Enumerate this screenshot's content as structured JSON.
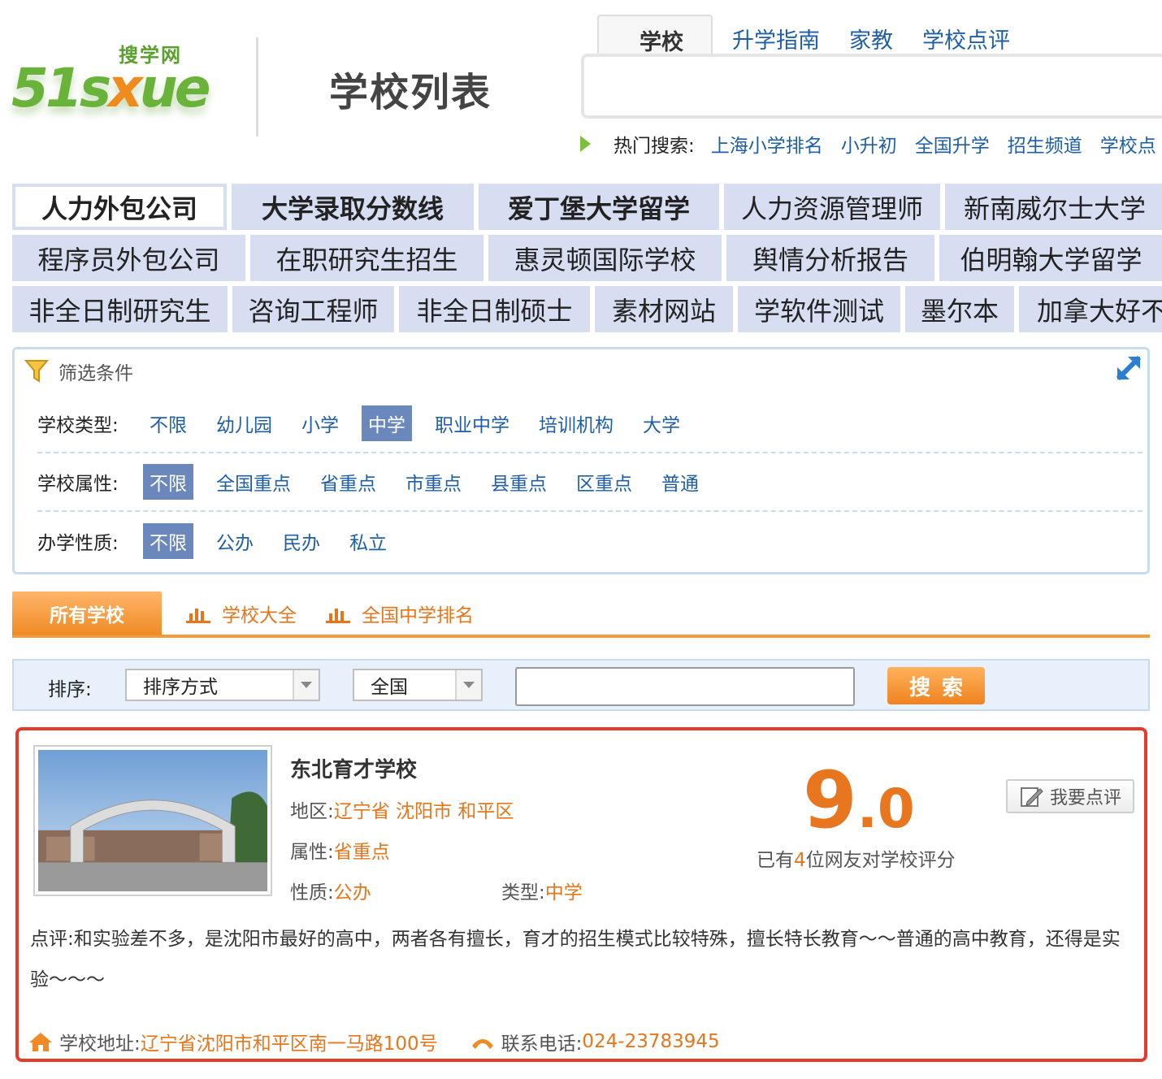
{
  "header": {
    "logo_sub": "搜学网",
    "logo_main_a": "51s",
    "logo_main_x": "x",
    "logo_main_b": "ue",
    "page_title": "学校列表",
    "search_tabs": [
      "学校",
      "升学指南",
      "家教",
      "学校点评"
    ],
    "search_value": "",
    "hot_label": "热门搜索:",
    "hot_links": [
      "上海小学排名",
      "小升初",
      "全国升学",
      "招生频道",
      "学校点"
    ]
  },
  "keywords": [
    [
      "人力外包公司",
      "大学录取分数线",
      "爱丁堡大学留学",
      "人力资源管理师",
      "新南威尔士大学"
    ],
    [
      "程序员外包公司",
      "在职研究生招生",
      "惠灵顿国际学校",
      "舆情分析报告",
      "伯明翰大学留学"
    ],
    [
      "非全日制研究生",
      "咨询工程师",
      "非全日制硕士",
      "素材网站",
      "学软件测试",
      "墨尔本",
      "加拿大好不"
    ]
  ],
  "filter": {
    "title": "筛选条件",
    "rows": [
      {
        "label": "学校类型:",
        "options": [
          "不限",
          "幼儿园",
          "小学",
          "中学",
          "职业中学",
          "培训机构",
          "大学"
        ],
        "selected": "中学"
      },
      {
        "label": "学校属性:",
        "options": [
          "不限",
          "全国重点",
          "省重点",
          "市重点",
          "县重点",
          "区重点",
          "普通"
        ],
        "selected": "不限"
      },
      {
        "label": "办学性质:",
        "options": [
          "不限",
          "公办",
          "民办",
          "私立"
        ],
        "selected": "不限"
      }
    ]
  },
  "tabs": {
    "active": "所有学校",
    "links": [
      "学校大全",
      "全国中学排名"
    ]
  },
  "sort": {
    "label": "排序:",
    "sort_select": "排序方式",
    "region_select": "全国",
    "keyword_value": "",
    "search_button": "搜索"
  },
  "school": {
    "name": "东北育才学校",
    "region_label": "地区:",
    "region": "辽宁省 沈阳市 和平区",
    "attr_label": "属性:",
    "attr": "省重点",
    "nature_label": "性质:",
    "nature": "公办",
    "type_label": "类型:",
    "type": "中学",
    "score_int": "9",
    "score_dec": ".0",
    "rated_prefix": "已有",
    "rated_count": "4",
    "rated_suffix": "位网友对学校评分",
    "review_button": "我要点评",
    "comment": "点评:和实验差不多，是沈阳市最好的高中，两者各有擅长，育才的招生模式比较特殊，擅长特长教育～～普通的高中教育，还得是实验～～～",
    "address_label": "学校地址:",
    "address": "辽宁省沈阳市和平区南一马路100号",
    "phone_label": "联系电话:",
    "phone": "024-23783945"
  },
  "colors": {
    "link_blue": "#1f5fa8",
    "accent_orange": "#e6761c",
    "keyword_bg": "#d7def1",
    "selected_filter": "#6b88bc",
    "card_border": "#e43b2a"
  }
}
